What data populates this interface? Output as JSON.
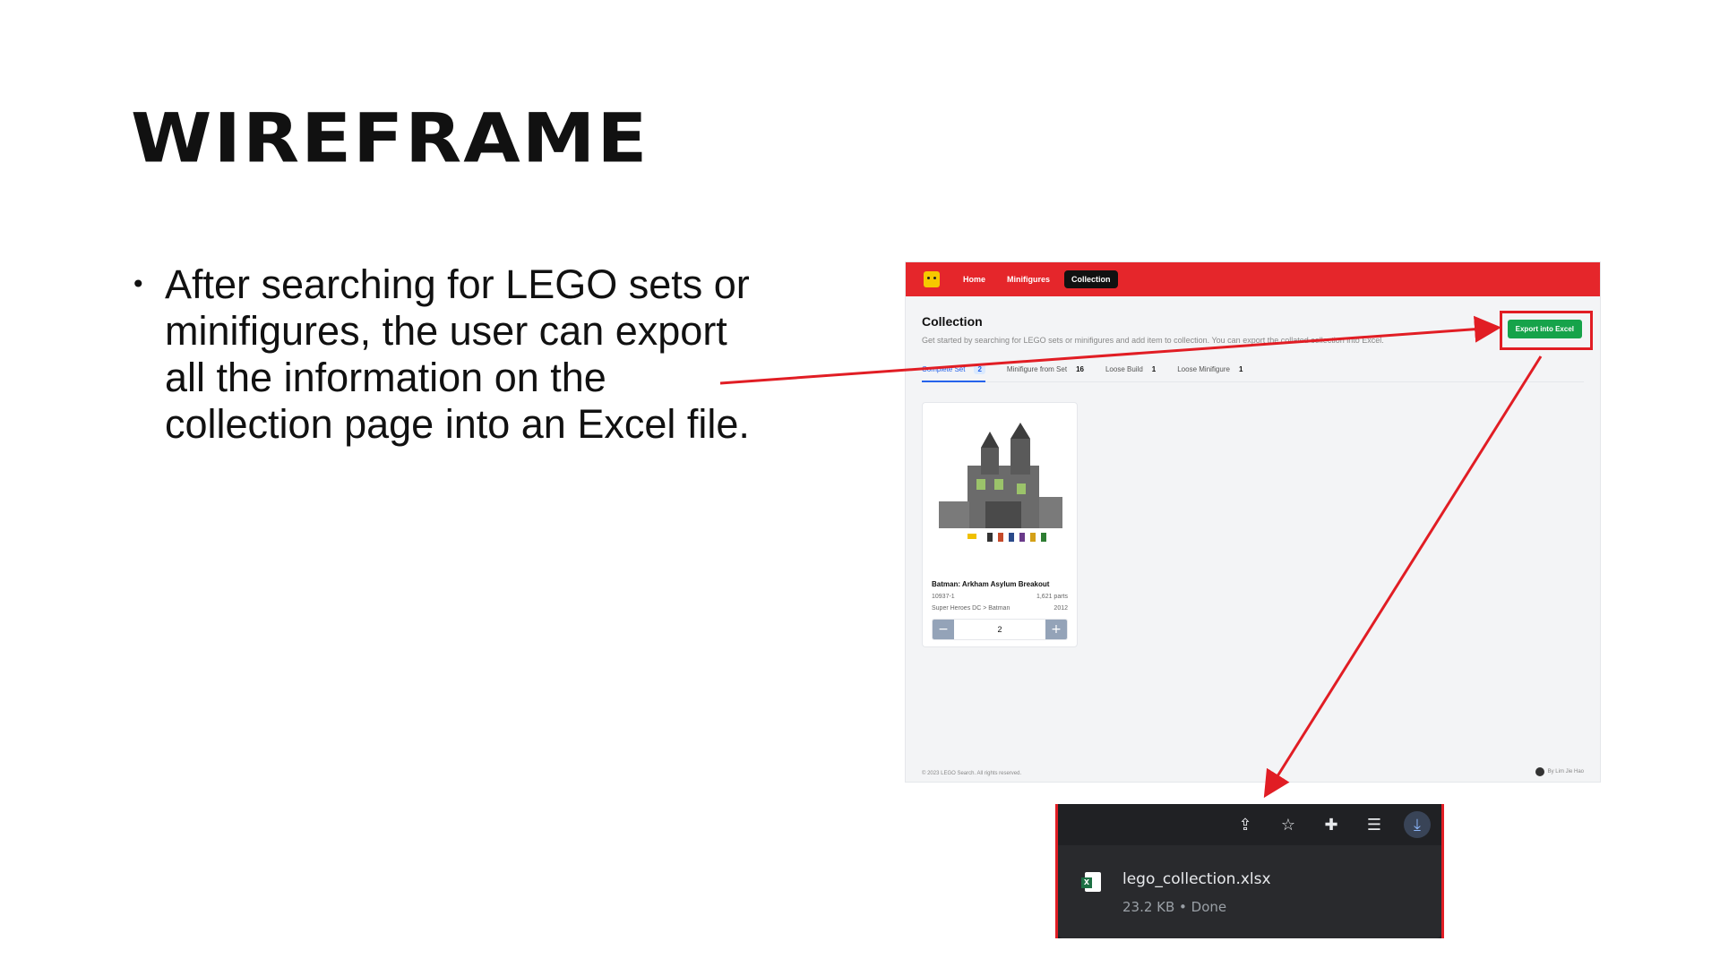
{
  "slide": {
    "title": "WIREFRAME",
    "bullet": "After searching for LEGO sets or minifigures, the user can export all the information on the collection page into an Excel file."
  },
  "app": {
    "nav": {
      "home": "Home",
      "minifigures": "Minifigures",
      "collection": "Collection"
    },
    "page_title": "Collection",
    "page_subtitle": "Get started by searching for LEGO sets or minifigures and add item to collection. You can export the collated collection into Excel.",
    "export_button": "Export into Excel",
    "tabs": [
      {
        "label": "Complete Set",
        "count": "2"
      },
      {
        "label": "Minifigure from Set",
        "count": "16"
      },
      {
        "label": "Loose Build",
        "count": "1"
      },
      {
        "label": "Loose Minifigure",
        "count": "1"
      }
    ],
    "card": {
      "title": "Batman: Arkham Asylum Breakout",
      "set_number": "10937-1",
      "parts": "1,621 parts",
      "theme": "Super Heroes DC > Batman",
      "year": "2012",
      "quantity": "2",
      "minus": "−",
      "plus": "+"
    },
    "footer_left": "© 2023 LEGO Search. All rights reserved.",
    "footer_right": "By Lim Jie Hao"
  },
  "download": {
    "filename": "lego_collection.xlsx",
    "status": "23.2 KB • Done",
    "icons": [
      "share-icon",
      "star-icon",
      "puzzle-icon",
      "reading-list-icon",
      "download-icon"
    ]
  },
  "colors": {
    "nav_red": "#e5262b",
    "export_green": "#16a34a",
    "annotation_red": "#e11d24"
  }
}
